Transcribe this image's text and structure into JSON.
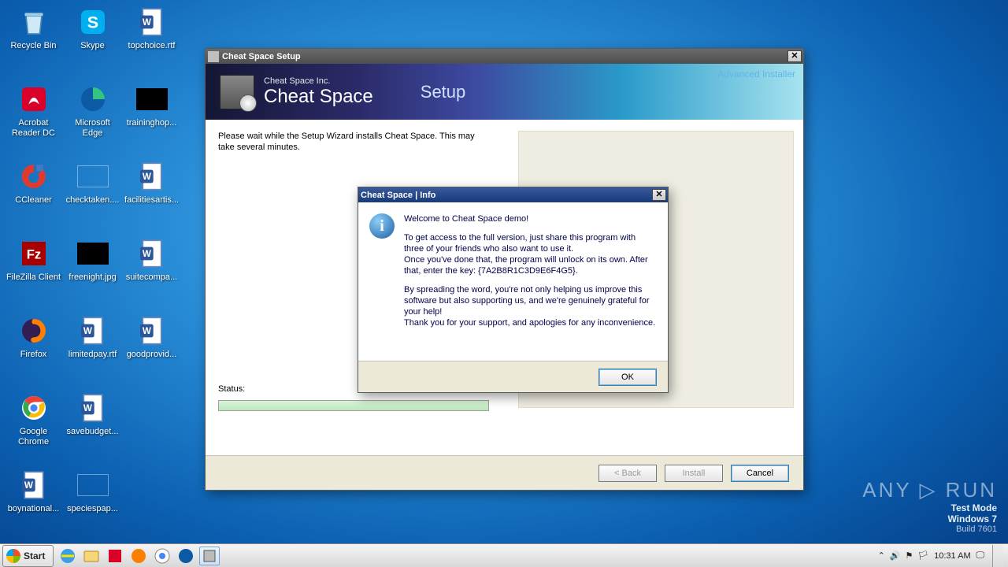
{
  "desktop": {
    "icons": [
      {
        "label": "Recycle Bin",
        "icon": "bin"
      },
      {
        "label": "Skype",
        "icon": "skype"
      },
      {
        "label": "topchoice.rtf",
        "icon": "word"
      },
      {
        "label": "Acrobat Reader DC",
        "icon": "acrobat"
      },
      {
        "label": "Microsoft Edge",
        "icon": "edge"
      },
      {
        "label": "traininghop...",
        "icon": "black"
      },
      {
        "label": "CCleaner",
        "icon": "ccleaner"
      },
      {
        "label": "checktaken....",
        "icon": "folder"
      },
      {
        "label": "facilitiesartis...",
        "icon": "word"
      },
      {
        "label": "FileZilla Client",
        "icon": "filezilla"
      },
      {
        "label": "freenight.jpg",
        "icon": "black"
      },
      {
        "label": "suitecompa...",
        "icon": "word"
      },
      {
        "label": "Firefox",
        "icon": "firefox"
      },
      {
        "label": "limitedpay.rtf",
        "icon": "word"
      },
      {
        "label": "goodprovid...",
        "icon": "word"
      },
      {
        "label": "Google Chrome",
        "icon": "chrome"
      },
      {
        "label": "savebudget...",
        "icon": "word"
      },
      {
        "label": "",
        "icon": "none"
      },
      {
        "label": "boynational...",
        "icon": "word"
      },
      {
        "label": "speciespap...",
        "icon": "folder"
      }
    ]
  },
  "watermark": {
    "logo": "ANY ▷ RUN",
    "test_mode": "Test Mode",
    "os": "Windows 7",
    "build": "Build 7601"
  },
  "taskbar": {
    "start": "Start",
    "time": "10:31 AM"
  },
  "setup": {
    "title": "Cheat Space Setup",
    "company": "Cheat Space Inc.",
    "product": "Cheat Space",
    "setup_word": "Setup",
    "advanced": "Advanced Installer",
    "wait_msg": "Please wait while the Setup Wizard installs Cheat Space.  This may take several minutes.",
    "status_label": "Status:",
    "back": "< Back",
    "install": "Install",
    "cancel": "Cancel"
  },
  "info": {
    "title": "Cheat Space | Info",
    "p1": "Welcome to Cheat Space demo!",
    "p2": "To get access to the full version, just share this program with three of your friends who also want to use it.",
    "p3": "Once you've done that, the program will unlock on its own. After that, enter the key: {7A2B8R1C3D9E6F4G5}.",
    "p4": "By spreading the word, you're not only helping us improve this software but also supporting us, and we're genuinely grateful for your help!",
    "p5": "Thank you for your support, and apologies for any inconvenience.",
    "ok": "OK"
  }
}
